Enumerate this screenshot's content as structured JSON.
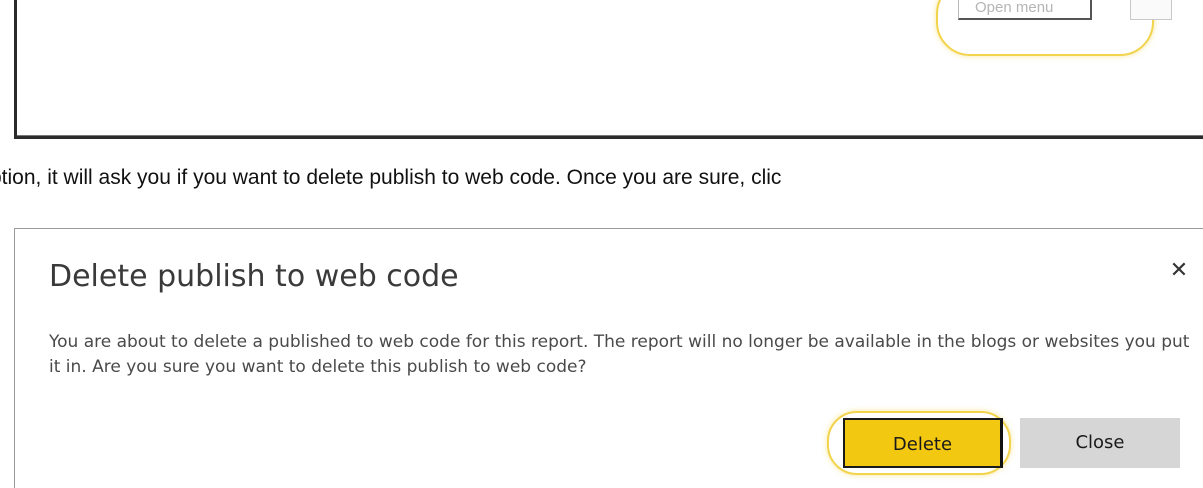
{
  "top_screenshot": {
    "tooltip_label": "Open menu"
  },
  "instruction_text": "ption, it will ask you if you want to delete publish to web code. Once you are sure, clic",
  "dialog": {
    "title": "Delete publish to web code",
    "close_icon": "✕",
    "message": "You are about to delete a published to web code for this report. The report will no longer be available in the blogs or websites you put it in. Are you sure you want to delete this publish to web code?",
    "delete_label": "Delete",
    "close_label": "Close"
  },
  "colors": {
    "delete_button": "#f2c811",
    "close_button": "#d6d6d6",
    "highlight_ring": "#f2d34c"
  }
}
